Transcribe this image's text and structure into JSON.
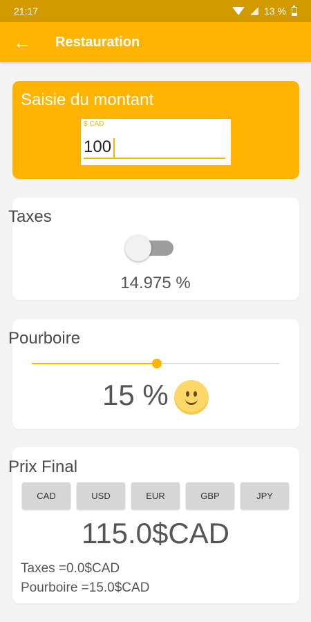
{
  "status": {
    "time": "21:17",
    "battery": "13 %"
  },
  "appbar": {
    "title": "Restauration"
  },
  "amount": {
    "title": "Saisie du montant",
    "field_label": "$ CAD",
    "value": "100"
  },
  "taxes": {
    "title": "Taxes",
    "toggle_on": false,
    "rate": "14.975 %"
  },
  "tip": {
    "title": "Pourboire",
    "percent": "15 %",
    "slider_fraction": 0.5
  },
  "final": {
    "title": "Prix Final",
    "currencies": [
      "CAD",
      "USD",
      "EUR",
      "GBP",
      "JPY"
    ],
    "price": "115.0$CAD",
    "taxes_line": "Taxes =0.0$CAD",
    "tip_line": "Pourboire =15.0$CAD"
  },
  "colors": {
    "accent": "#ffb400",
    "status_bar": "#d19b00"
  }
}
